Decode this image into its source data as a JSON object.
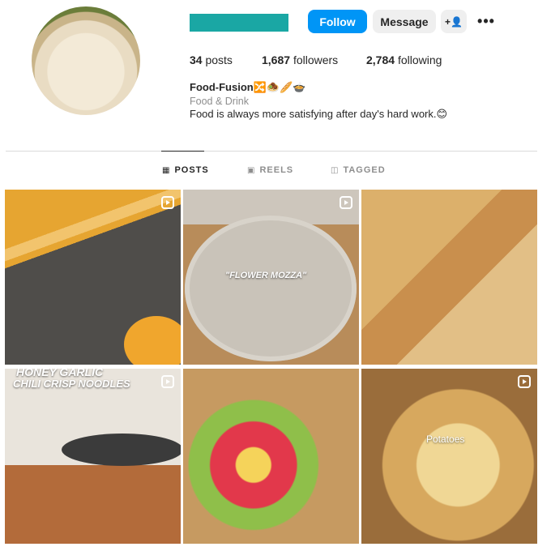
{
  "profile": {
    "avatar_icon": "avatar-noodle-bowl",
    "follow_label": "Follow",
    "message_label": "Message",
    "suggest_icon": "add-person-icon",
    "suggest_label": "+2",
    "more_label": "•••",
    "stats": {
      "posts_count": "34",
      "posts_label": "posts",
      "followers_count": "1,687",
      "followers_label": "followers",
      "following_count": "2,784",
      "following_label": "following"
    },
    "bio": {
      "name": "Food-Fusion🔀🧆🥖🍲",
      "category": "Food & Drink",
      "text": "Food is always more satisfying after day's hard work.😊"
    }
  },
  "tabs": [
    {
      "label": "POSTS",
      "icon": "▦",
      "active": true
    },
    {
      "label": "REELS",
      "icon": "▣",
      "active": false
    },
    {
      "label": "TAGGED",
      "icon": "◫",
      "active": false
    }
  ],
  "grid": {
    "t2_text": "\"FLOWER MOZZA\"",
    "t4_text_top": "HONEY GARLIC",
    "t4_text": "CHILI CRISP NOODLES",
    "t6_text": "Potatoes"
  },
  "colors": {
    "follow_button": "#0095f6",
    "username_bar": "#1aa7a4"
  }
}
